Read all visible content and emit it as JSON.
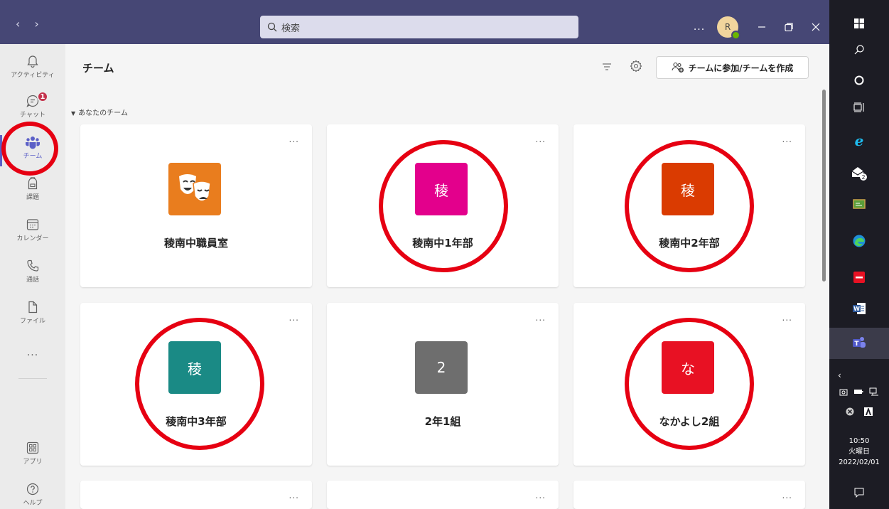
{
  "titlebar": {
    "back_label": "‹",
    "forward_label": "›",
    "search_placeholder": "検索",
    "more_label": "...",
    "avatar_initial": "R"
  },
  "rail": {
    "items": [
      {
        "label": "アクティビティ",
        "icon": "bell-icon"
      },
      {
        "label": "チャット",
        "icon": "chat-icon",
        "badge": "1"
      },
      {
        "label": "チーム",
        "icon": "teams-icon"
      },
      {
        "label": "課題",
        "icon": "backpack-icon"
      },
      {
        "label": "カレンダー",
        "icon": "calendar-icon"
      },
      {
        "label": "通話",
        "icon": "phone-icon"
      },
      {
        "label": "ファイル",
        "icon": "file-icon"
      },
      {
        "label": "...",
        "icon": "more-icon"
      },
      {
        "label": "アプリ",
        "icon": "apps-icon"
      },
      {
        "label": "ヘルプ",
        "icon": "help-icon"
      }
    ]
  },
  "main": {
    "title": "チーム",
    "join_button": "チームに参加/チームを作成",
    "section_label": "あなたのチーム",
    "teams": [
      {
        "name": "稜南中職員室",
        "tile": "",
        "color": "#e97d1e",
        "icon": "theater-masks-icon"
      },
      {
        "name": "稜南中1年部",
        "tile": "稜",
        "color": "#e3008c"
      },
      {
        "name": "稜南中2年部",
        "tile": "稜",
        "color": "#da3b01"
      },
      {
        "name": "稜南中3年部",
        "tile": "稜",
        "color": "#1a8a85"
      },
      {
        "name": "2年1組",
        "tile": "2",
        "color": "#6e6e6e"
      },
      {
        "name": "なかよし2組",
        "tile": "な",
        "color": "#e81123"
      }
    ],
    "card_more": "..."
  },
  "taskbar": {
    "mail_badge": "2",
    "time": "10:50",
    "day": "火曜日",
    "date": "2022/02/01"
  },
  "colors": {
    "titlebar": "#464775",
    "accent": "#5b5fc7",
    "annotation_ring": "#e60012"
  }
}
